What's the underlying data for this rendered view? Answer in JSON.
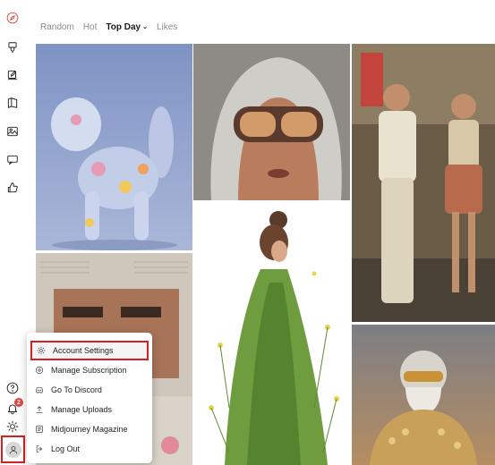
{
  "tabs": [
    {
      "label": "Random"
    },
    {
      "label": "Hot"
    },
    {
      "label": "Top Day",
      "caret": "⌄"
    },
    {
      "label": "Likes"
    }
  ],
  "sidebar": {
    "items": [
      {
        "icon": "compass-icon"
      },
      {
        "icon": "brush-icon"
      },
      {
        "icon": "edit-icon"
      },
      {
        "icon": "book-icon"
      },
      {
        "icon": "image-icon"
      },
      {
        "icon": "chat-icon"
      },
      {
        "icon": "thumbs-up-icon"
      },
      {
        "icon": "help-icon"
      },
      {
        "icon": "bell-icon"
      },
      {
        "icon": "sun-icon"
      },
      {
        "icon": "user-icon"
      }
    ],
    "notification_count": "2"
  },
  "menu": {
    "items": [
      {
        "label": "Account Settings",
        "icon": "gear-icon"
      },
      {
        "label": "Manage Subscription",
        "icon": "credit-card-icon"
      },
      {
        "label": "Go To Discord",
        "icon": "discord-icon"
      },
      {
        "label": "Manage Uploads",
        "icon": "upload-icon"
      },
      {
        "label": "Midjourney Magazine",
        "icon": "magazine-icon"
      },
      {
        "label": "Log Out",
        "icon": "logout-icon"
      }
    ]
  },
  "colors": {
    "accent": "#e0443e",
    "highlight_border": "#d42020"
  }
}
